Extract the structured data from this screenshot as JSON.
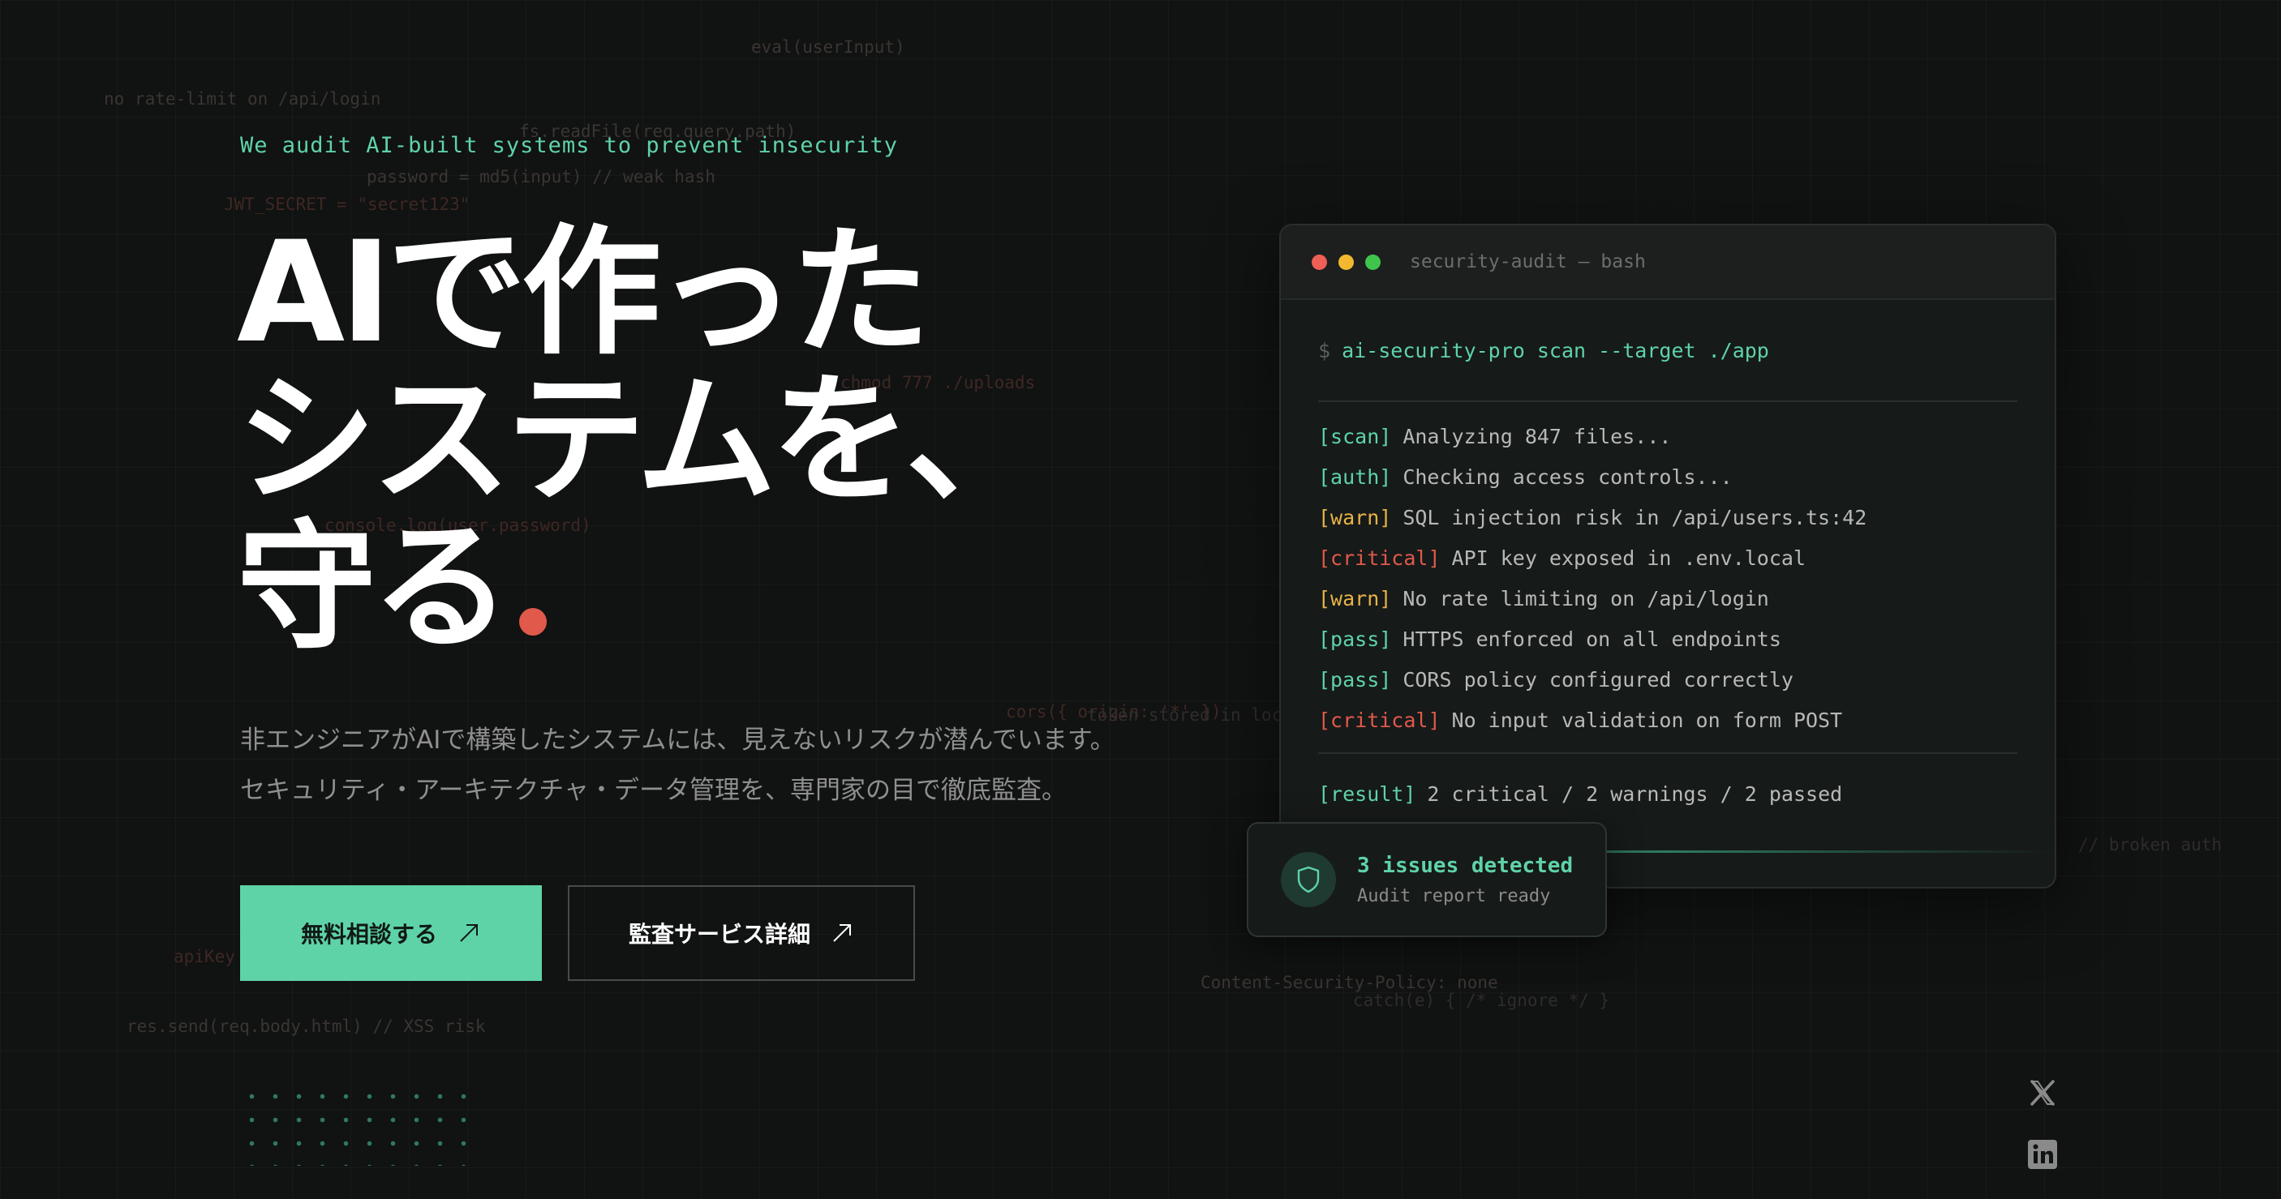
{
  "background_code": [
    "eval(userInput)",
    "no rate-limit on /api/login",
    "fs.readFile(req.query.path)",
    "password = md5(input) // weak hash",
    "JWT_SECRET = \"secret123\"",
    "chmod 777 ./uploads",
    "console.log(user.password)",
    "cors({ origin: '*' })",
    "token stored in localStorage",
    "// broken auth",
    "apiKey",
    "res.send(req.body.html) // XSS risk",
    "Content-Security-Policy: none",
    "catch(e) { /* ignore */ }"
  ],
  "hero": {
    "eyebrow": "We audit AI-built systems to prevent insecurity",
    "headline_line1": "AIで作った",
    "headline_line2": "システムを、",
    "headline_line3": "守る",
    "description_line1": "非エンジニアがAIで構築したシステムには、見えないリスクが潜んでいます。",
    "description_line2": "セキュリティ・アーキテクチャ・データ管理を、専門家の目で徹底監査。",
    "primary_button": "無料相談する",
    "secondary_button": "監査サービス詳細"
  },
  "terminal": {
    "title": "security-audit — bash",
    "prompt": "$",
    "command": "ai-security-pro scan --target ./app",
    "lines": [
      {
        "tag": "[scan]",
        "type": "scan",
        "text": "Analyzing 847 files..."
      },
      {
        "tag": "[auth]",
        "type": "auth",
        "text": "Checking access controls..."
      },
      {
        "tag": "[warn]",
        "type": "warn",
        "text": "SQL injection risk in /api/users.ts:42"
      },
      {
        "tag": "[critical]",
        "type": "critical",
        "text": "API key exposed in .env.local"
      },
      {
        "tag": "[warn]",
        "type": "warn",
        "text": "No rate limiting on /api/login"
      },
      {
        "tag": "[pass]",
        "type": "pass",
        "text": "HTTPS enforced on all endpoints"
      },
      {
        "tag": "[pass]",
        "type": "pass",
        "text": "CORS policy configured correctly"
      },
      {
        "tag": "[critical]",
        "type": "critical",
        "text": "No input validation on form POST"
      }
    ],
    "result_tag": "[result]",
    "result_text": "2 critical / 2 warnings / 2 passed"
  },
  "status_card": {
    "title": "3 issues detected",
    "subtitle": "Audit report ready"
  },
  "social": {
    "x_icon": "x-icon",
    "linkedin_icon": "linkedin-icon"
  },
  "colors": {
    "accent": "#5fd3a8",
    "critical": "#e0594a",
    "warn": "#e8b246",
    "background": "#111212"
  }
}
